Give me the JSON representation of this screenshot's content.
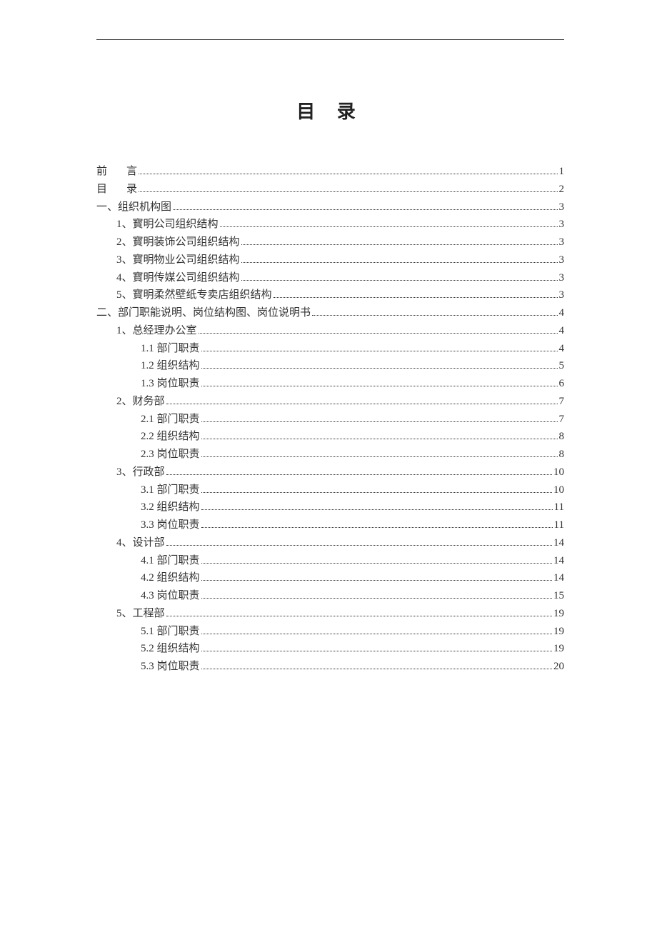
{
  "title": "目 录",
  "toc": [
    {
      "level": 0,
      "label": "前　言",
      "page": "1",
      "special": true,
      "prefix": "前",
      "suffix": "言"
    },
    {
      "level": 0,
      "label": "目　录",
      "page": "2",
      "special": true,
      "prefix": "目",
      "suffix": "录"
    },
    {
      "level": 0,
      "label": "一、组织机构图",
      "page": "3"
    },
    {
      "level": 1,
      "label": "1、寳明公司组织结构",
      "page": "3"
    },
    {
      "level": 1,
      "label": "2、寳明装饰公司组织结构",
      "page": "3"
    },
    {
      "level": 1,
      "label": "3、寳明物业公司组织结构",
      "page": "3"
    },
    {
      "level": 1,
      "label": "4、寳明传媒公司组织结构",
      "page": "3"
    },
    {
      "level": 1,
      "label": "5、寳明柔然壁纸专卖店组织结构",
      "page": "3"
    },
    {
      "level": 0,
      "label": "二、部门职能说明、岗位结构图、岗位说明书",
      "page": "4"
    },
    {
      "level": 1,
      "label": "1、总经理办公室",
      "page": "4"
    },
    {
      "level": 2,
      "label": "1.1 部门职责",
      "page": "4"
    },
    {
      "level": 2,
      "label": "1.2 组织结构",
      "page": "5"
    },
    {
      "level": 2,
      "label": "1.3 岗位职责",
      "page": "6"
    },
    {
      "level": 1,
      "label": "2、财务部",
      "page": "7"
    },
    {
      "level": 2,
      "label": "2.1 部门职责",
      "page": "7"
    },
    {
      "level": 2,
      "label": "2.2 组织结构",
      "page": "8"
    },
    {
      "level": 2,
      "label": "2.3 岗位职责",
      "page": "8"
    },
    {
      "level": 1,
      "label": "3、行政部",
      "page": "10"
    },
    {
      "level": 2,
      "label": "3.1 部门职责",
      "page": "10"
    },
    {
      "level": 2,
      "label": "3.2 组织结构",
      "page": "11"
    },
    {
      "level": 2,
      "label": "3.3 岗位职责",
      "page": "11"
    },
    {
      "level": 1,
      "label": "4、设计部",
      "page": "14"
    },
    {
      "level": 2,
      "label": "4.1 部门职责",
      "page": "14"
    },
    {
      "level": 2,
      "label": "4.2 组织结构",
      "page": "14"
    },
    {
      "level": 2,
      "label": "4.3 岗位职责",
      "page": "15"
    },
    {
      "level": 1,
      "label": "5、工程部",
      "page": "19"
    },
    {
      "level": 2,
      "label": "5.1 部门职责",
      "page": "19"
    },
    {
      "level": 2,
      "label": "5.2 组织结构",
      "page": "19"
    },
    {
      "level": 2,
      "label": "5.3 岗位职责",
      "page": "20"
    }
  ]
}
